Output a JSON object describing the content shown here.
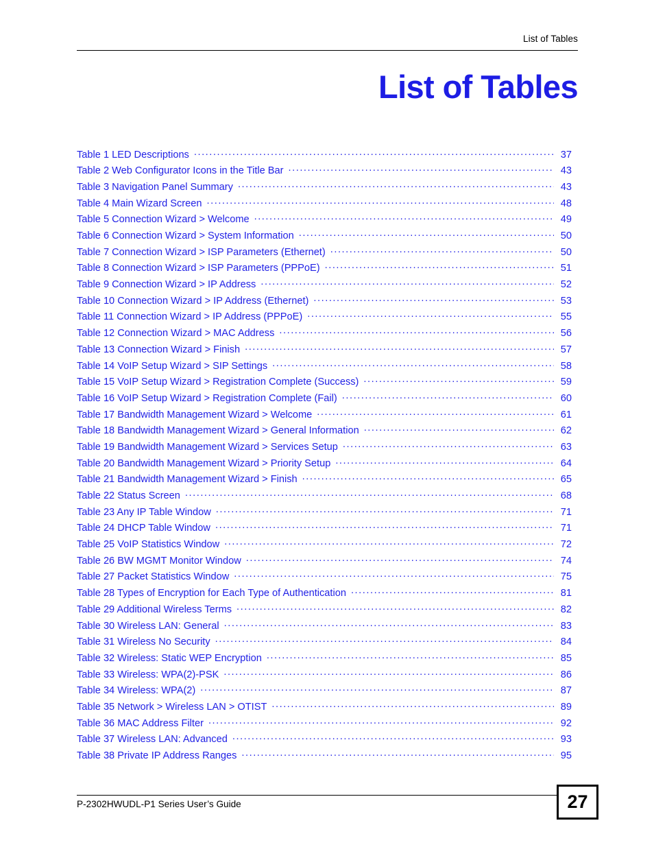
{
  "header": {
    "running_head": "List of Tables"
  },
  "title": "List of Tables",
  "colors": {
    "link_blue": "#2222e6",
    "title_blue": "#1d1de4",
    "rule_black": "#000000"
  },
  "toc": {
    "entries": [
      {
        "label": "Table 1 LED Descriptions",
        "page": "37"
      },
      {
        "label": "Table 2 Web Configurator Icons in the Title Bar",
        "page": "43"
      },
      {
        "label": "Table 3 Navigation Panel Summary",
        "page": "43"
      },
      {
        "label": "Table 4 Main Wizard Screen",
        "page": "48"
      },
      {
        "label": "Table 5 Connection Wizard > Welcome",
        "page": "49"
      },
      {
        "label": "Table 6 Connection Wizard > System Information",
        "page": "50"
      },
      {
        "label": "Table 7 Connection Wizard > ISP Parameters (Ethernet)",
        "page": "50"
      },
      {
        "label": "Table 8 Connection Wizard > ISP Parameters (PPPoE)",
        "page": "51"
      },
      {
        "label": "Table 9 Connection Wizard > IP Address",
        "page": "52"
      },
      {
        "label": "Table 10 Connection Wizard > IP Address (Ethernet)",
        "page": "53"
      },
      {
        "label": "Table 11 Connection Wizard > IP Address (PPPoE)",
        "page": "55"
      },
      {
        "label": "Table 12 Connection Wizard > MAC Address",
        "page": "56"
      },
      {
        "label": "Table 13 Connection Wizard > Finish",
        "page": "57"
      },
      {
        "label": "Table 14 VoIP Setup Wizard > SIP Settings",
        "page": "58"
      },
      {
        "label": "Table 15 VoIP Setup Wizard > Registration Complete (Success)",
        "page": "59"
      },
      {
        "label": "Table 16 VoIP Setup Wizard > Registration Complete (Fail)",
        "page": "60"
      },
      {
        "label": "Table 17 Bandwidth Management Wizard > Welcome",
        "page": "61"
      },
      {
        "label": "Table 18 Bandwidth Management Wizard > General Information",
        "page": "62"
      },
      {
        "label": "Table 19 Bandwidth Management Wizard > Services Setup",
        "page": "63"
      },
      {
        "label": "Table 20 Bandwidth Management Wizard > Priority Setup",
        "page": "64"
      },
      {
        "label": "Table 21 Bandwidth Management Wizard > Finish",
        "page": "65"
      },
      {
        "label": "Table 22 Status Screen",
        "page": "68"
      },
      {
        "label": "Table 23 Any IP Table Window",
        "page": "71"
      },
      {
        "label": "Table 24 DHCP Table Window",
        "page": "71"
      },
      {
        "label": "Table 25 VoIP Statistics Window",
        "page": "72"
      },
      {
        "label": "Table 26 BW MGMT Monitor Window",
        "page": "74"
      },
      {
        "label": "Table 27 Packet Statistics Window",
        "page": "75"
      },
      {
        "label": "Table 28 Types of Encryption for Each Type of Authentication",
        "page": "81"
      },
      {
        "label": "Table 29 Additional Wireless Terms",
        "page": "82"
      },
      {
        "label": "Table 30 Wireless LAN: General",
        "page": "83"
      },
      {
        "label": "Table 31 Wireless No Security",
        "page": "84"
      },
      {
        "label": "Table 32 Wireless: Static WEP Encryption",
        "page": "85"
      },
      {
        "label": "Table 33 Wireless: WPA(2)-PSK",
        "page": "86"
      },
      {
        "label": "Table 34 Wireless: WPA(2)",
        "page": "87"
      },
      {
        "label": "Table 35 Network > Wireless LAN > OTIST",
        "page": "89"
      },
      {
        "label": "Table 36 MAC Address Filter",
        "page": "92"
      },
      {
        "label": "Table 37 Wireless LAN: Advanced",
        "page": "93"
      },
      {
        "label": "Table 38 Private IP Address Ranges",
        "page": "95"
      }
    ]
  },
  "footer": {
    "guide_title": "P-2302HWUDL-P1 Series User’s Guide",
    "page_number": "27"
  }
}
